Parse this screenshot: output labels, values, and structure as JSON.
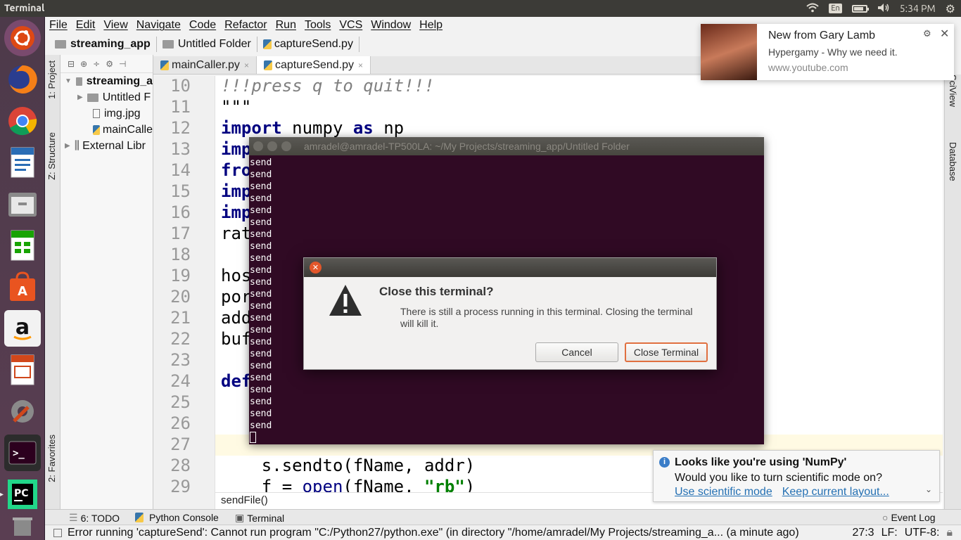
{
  "system_bar": {
    "app_title": "Terminal",
    "keyboard_layout": "En",
    "time": "5:34 PM",
    "battery_level": 0.75
  },
  "launcher": {
    "items": [
      "ubuntu-dash",
      "firefox",
      "chrome",
      "libreoffice-writer",
      "files",
      "libreoffice-calc",
      "software-center",
      "amazon",
      "libreoffice-impress",
      "system-settings",
      "terminal",
      "pycharm",
      "trash"
    ]
  },
  "menubar": {
    "items": [
      "File",
      "Edit",
      "View",
      "Navigate",
      "Code",
      "Refactor",
      "Run",
      "Tools",
      "VCS",
      "Window",
      "Help"
    ]
  },
  "breadcrumbs": [
    "streaming_app",
    "Untitled Folder",
    "captureSend.py"
  ],
  "left_tabs": {
    "project": "1: Project",
    "structure": "Z: Structure",
    "favorites": "2: Favorites"
  },
  "right_tabs": {
    "sciview": "SciView",
    "database": "Database"
  },
  "project_tree": [
    {
      "label": "streaming_a",
      "bold": true
    },
    {
      "label": "Untitled F"
    },
    {
      "label": "img.jpg"
    },
    {
      "label": "mainCalle"
    },
    {
      "label": "External Libr"
    }
  ],
  "editor_tabs": [
    {
      "label": "mainCaller.py",
      "close": "×"
    },
    {
      "label": "captureSend.py",
      "close": "×"
    }
  ],
  "editor": {
    "line_numbers": [
      "10",
      "11",
      "12",
      "13",
      "14",
      "15",
      "16",
      "17",
      "18",
      "19",
      "20",
      "21",
      "22",
      "23",
      "24",
      "25",
      "26",
      "27",
      "28",
      "29"
    ],
    "lines": [
      {
        "cmt": "!!!press q to quit!!!"
      },
      {
        "plain": "\"\"\""
      },
      {
        "kw": "import",
        "rest": " numpy ",
        "kw2": "as",
        "rest2": " np"
      },
      {
        "kw": "imp"
      },
      {
        "kw": "fro"
      },
      {
        "kw": "imp"
      },
      {
        "kw": "imp"
      },
      {
        "plain": "rat"
      },
      {
        "plain": ""
      },
      {
        "plain": "hos"
      },
      {
        "plain": "por"
      },
      {
        "plain": "add"
      },
      {
        "plain": "buf"
      },
      {
        "plain": ""
      },
      {
        "kw": "def"
      },
      {
        "plain": ""
      },
      {
        "plain": ""
      },
      {
        "plain": ""
      },
      {
        "plain": "    s.sendto(fName, addr)"
      },
      {
        "plain": "    f = ",
        "kw": "open",
        "rest": "(fName, ",
        "str": "\"rb\"",
        "rest2": ")"
      }
    ],
    "function_footer": "sendFile()"
  },
  "terminal": {
    "title": "amradel@amradel-TP500LA: ~/My Projects/streaming_app/Untitled Folder",
    "output_lines": [
      "send",
      "send",
      "send",
      "send",
      "send",
      "send",
      "send",
      "send",
      "send",
      "send",
      "send",
      "send",
      "send",
      "send",
      "send",
      "send",
      "send",
      "send",
      "send",
      "send",
      "send",
      "send",
      "send"
    ]
  },
  "dialog": {
    "title": "Close this terminal?",
    "message": "There is still a process running in this terminal. Closing the terminal will kill it.",
    "cancel_label": "Cancel",
    "confirm_label": "Close Terminal"
  },
  "notification": {
    "title": "New from Gary Lamb",
    "body": "Hypergamy - Why we need it.",
    "source": "www.youtube.com"
  },
  "numpy_popup": {
    "heading": "Looks like you're using 'NumPy'",
    "question": "Would you like to turn scientific mode on?",
    "link1": "Use scientific mode",
    "link2": "Keep current layout..."
  },
  "bottom_tools": {
    "todo": "6: TODO",
    "python_console": "Python Console",
    "terminal": "Terminal",
    "event_log": "Event Log"
  },
  "status": {
    "message": "Error running 'captureSend': Cannot run program \"C:/Python27/python.exe\" (in directory \"/home/amradel/My Projects/streaming_a... (a minute ago)",
    "position": "27:3",
    "line_sep": "LF:",
    "encoding": "UTF-8:"
  },
  "colors": {
    "terminal_bg": "#300a24",
    "launcher_bg": "#4d3a4a",
    "keyword": "#000080"
  }
}
